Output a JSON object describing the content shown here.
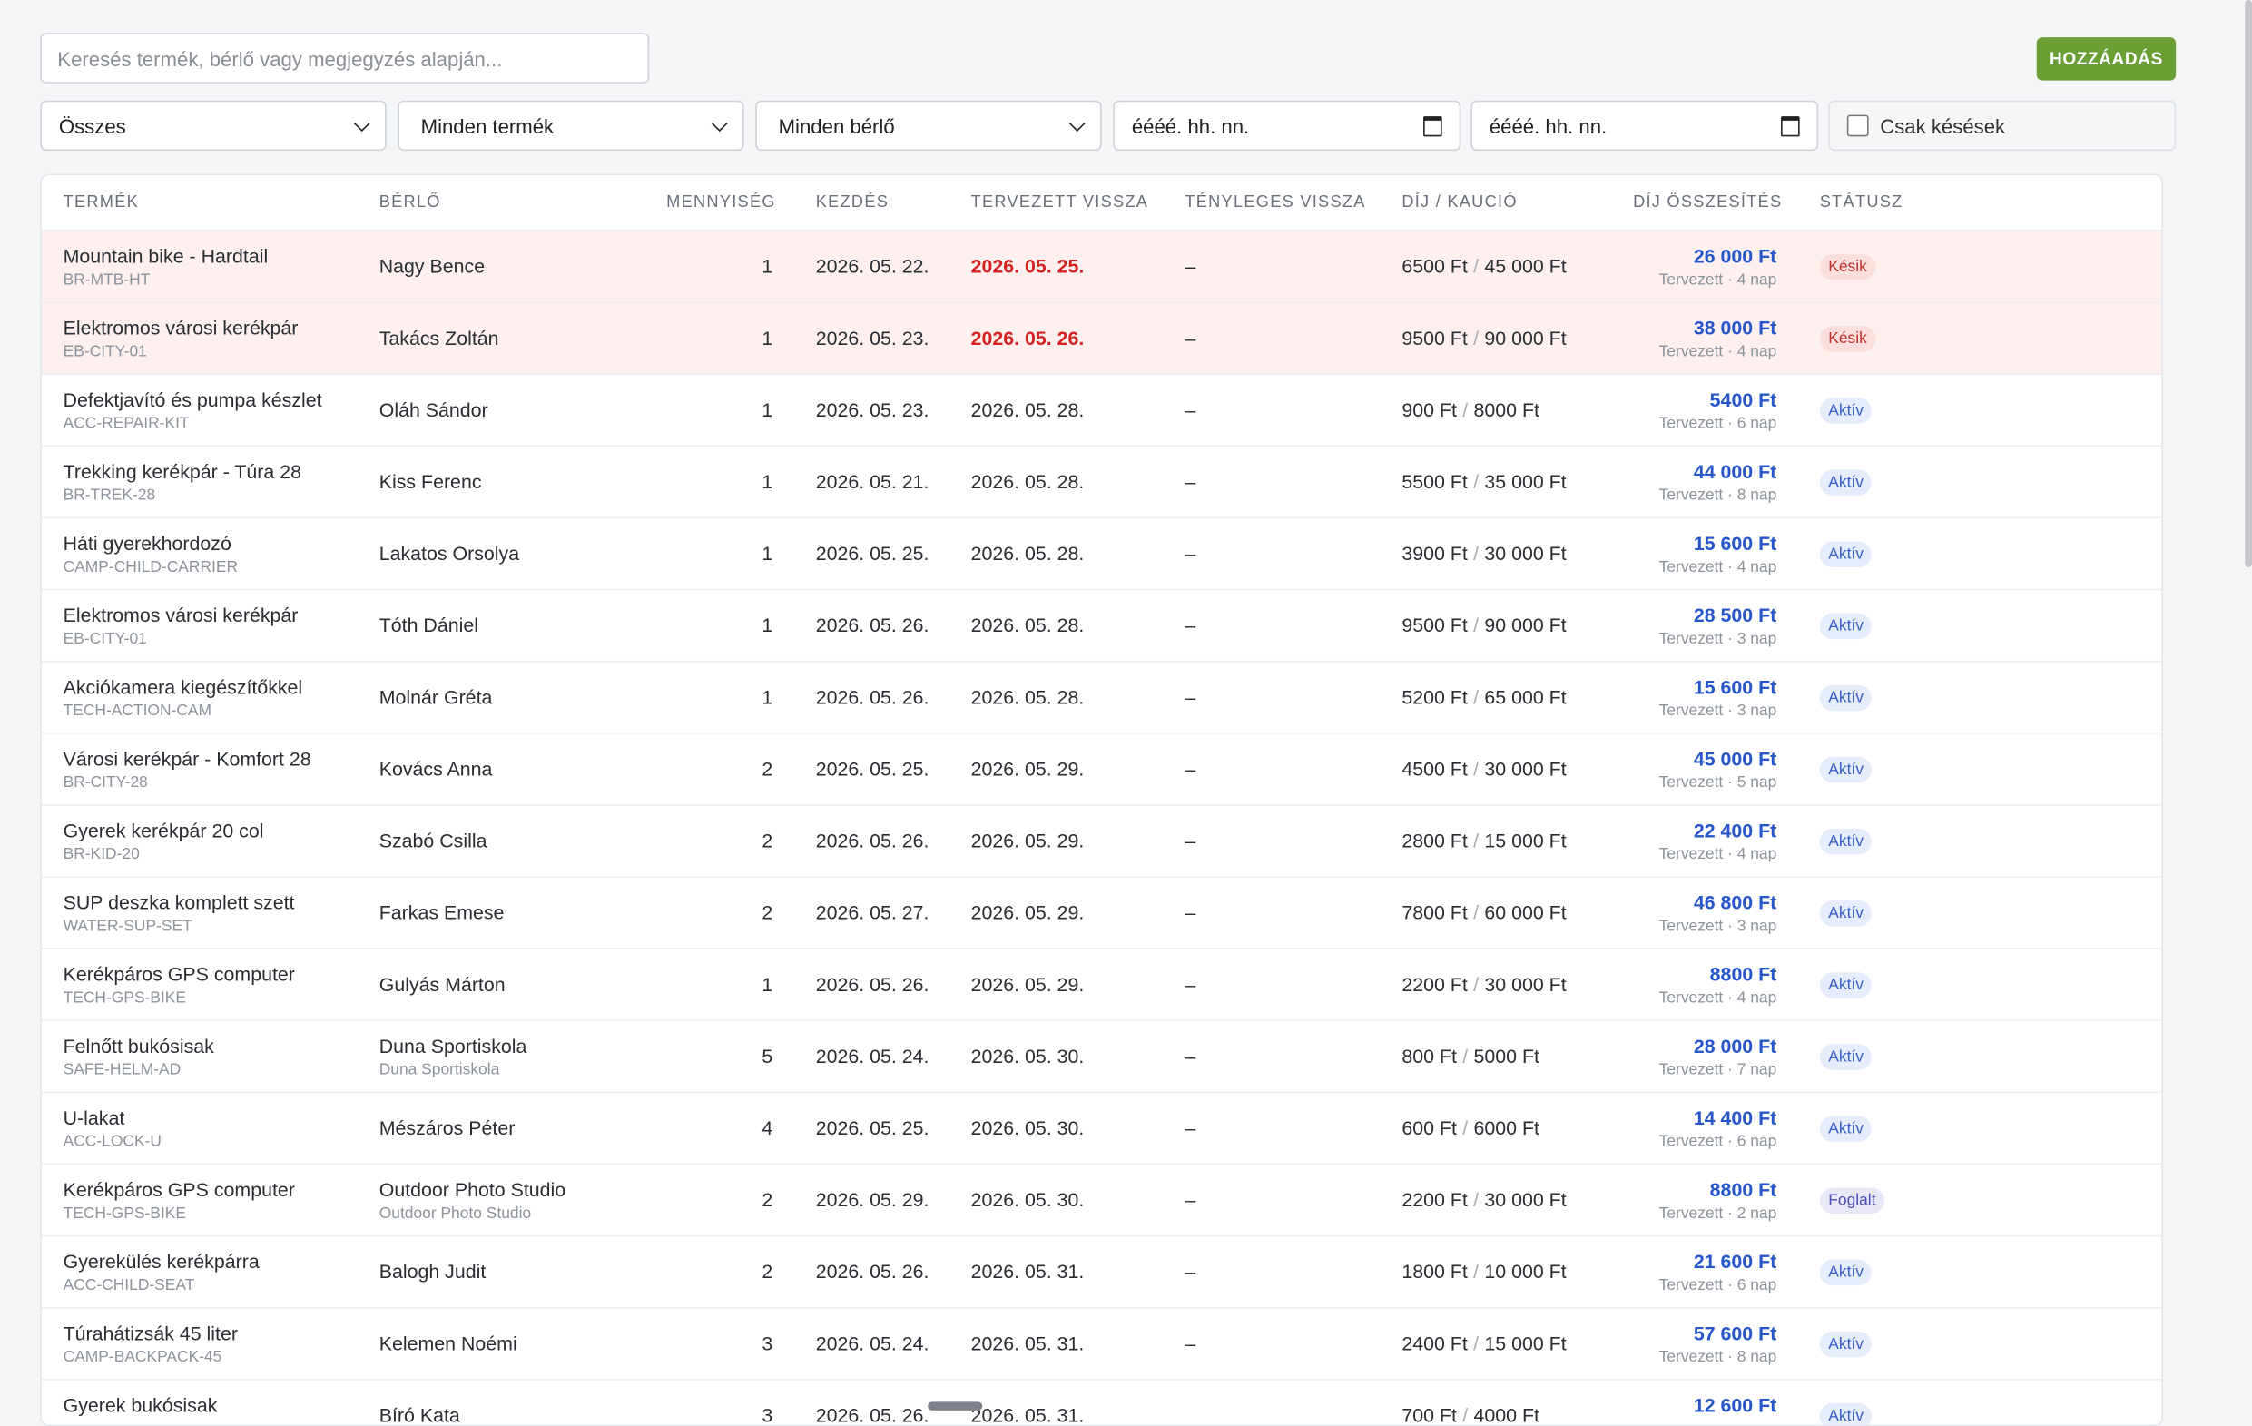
{
  "search": {
    "placeholder": "Keresés termék, bérlő vagy megjegyzés alapján..."
  },
  "toolbar": {
    "add_label": "HOZZÁADÁS"
  },
  "filters": {
    "status": "Összes",
    "product": "Minden termék",
    "renter": "Minden bérlő",
    "date_from": "éééé. hh. nn.",
    "date_to": "éééé. hh. nn.",
    "late_only": "Csak késések"
  },
  "table": {
    "headers": [
      "TERMÉK",
      "BÉRLŐ",
      "MENNYISÉG",
      "KEZDÉS",
      "TERVEZETT VISSZA",
      "TÉNYLEGES VISSZA",
      "DÍJ / KAUCIÓ",
      "DÍJ ÖSSZESÍTÉS",
      "STÁTUSZ"
    ],
    "rows": [
      {
        "product": "Mountain bike - Hardtail",
        "code": "BR-MTB-HT",
        "renter": "Nagy Bence",
        "renter_sub": "",
        "qty": "1",
        "start": "2026. 05. 22.",
        "planned": "2026. 05. 25.",
        "actual": "–",
        "fee": "6500 Ft",
        "deposit": "45 000 Ft",
        "total": "26 000 Ft",
        "total_sub": "Tervezett · 4 nap",
        "status": "Késik",
        "kind": "late"
      },
      {
        "product": "Elektromos városi kerékpár",
        "code": "EB-CITY-01",
        "renter": "Takács Zoltán",
        "renter_sub": "",
        "qty": "1",
        "start": "2026. 05. 23.",
        "planned": "2026. 05. 26.",
        "actual": "–",
        "fee": "9500 Ft",
        "deposit": "90 000 Ft",
        "total": "38 000 Ft",
        "total_sub": "Tervezett · 4 nap",
        "status": "Késik",
        "kind": "late"
      },
      {
        "product": "Defektjavító és pumpa készlet",
        "code": "ACC-REPAIR-KIT",
        "renter": "Oláh Sándor",
        "renter_sub": "",
        "qty": "1",
        "start": "2026. 05. 23.",
        "planned": "2026. 05. 28.",
        "actual": "–",
        "fee": "900 Ft",
        "deposit": "8000 Ft",
        "total": "5400 Ft",
        "total_sub": "Tervezett · 6 nap",
        "status": "Aktív",
        "kind": "active"
      },
      {
        "product": "Trekking kerékpár - Túra 28",
        "code": "BR-TREK-28",
        "renter": "Kiss Ferenc",
        "renter_sub": "",
        "qty": "1",
        "start": "2026. 05. 21.",
        "planned": "2026. 05. 28.",
        "actual": "–",
        "fee": "5500 Ft",
        "deposit": "35 000 Ft",
        "total": "44 000 Ft",
        "total_sub": "Tervezett · 8 nap",
        "status": "Aktív",
        "kind": "active"
      },
      {
        "product": "Háti gyerekhordozó",
        "code": "CAMP-CHILD-CARRIER",
        "renter": "Lakatos Orsolya",
        "renter_sub": "",
        "qty": "1",
        "start": "2026. 05. 25.",
        "planned": "2026. 05. 28.",
        "actual": "–",
        "fee": "3900 Ft",
        "deposit": "30 000 Ft",
        "total": "15 600 Ft",
        "total_sub": "Tervezett · 4 nap",
        "status": "Aktív",
        "kind": "active"
      },
      {
        "product": "Elektromos városi kerékpár",
        "code": "EB-CITY-01",
        "renter": "Tóth Dániel",
        "renter_sub": "",
        "qty": "1",
        "start": "2026. 05. 26.",
        "planned": "2026. 05. 28.",
        "actual": "–",
        "fee": "9500 Ft",
        "deposit": "90 000 Ft",
        "total": "28 500 Ft",
        "total_sub": "Tervezett · 3 nap",
        "status": "Aktív",
        "kind": "active"
      },
      {
        "product": "Akciókamera kiegészítőkkel",
        "code": "TECH-ACTION-CAM",
        "renter": "Molnár Gréta",
        "renter_sub": "",
        "qty": "1",
        "start": "2026. 05. 26.",
        "planned": "2026. 05. 28.",
        "actual": "–",
        "fee": "5200 Ft",
        "deposit": "65 000 Ft",
        "total": "15 600 Ft",
        "total_sub": "Tervezett · 3 nap",
        "status": "Aktív",
        "kind": "active"
      },
      {
        "product": "Városi kerékpár - Komfort 28",
        "code": "BR-CITY-28",
        "renter": "Kovács Anna",
        "renter_sub": "",
        "qty": "2",
        "start": "2026. 05. 25.",
        "planned": "2026. 05. 29.",
        "actual": "–",
        "fee": "4500 Ft",
        "deposit": "30 000 Ft",
        "total": "45 000 Ft",
        "total_sub": "Tervezett · 5 nap",
        "status": "Aktív",
        "kind": "active"
      },
      {
        "product": "Gyerek kerékpár 20 col",
        "code": "BR-KID-20",
        "renter": "Szabó Csilla",
        "renter_sub": "",
        "qty": "2",
        "start": "2026. 05. 26.",
        "planned": "2026. 05. 29.",
        "actual": "–",
        "fee": "2800 Ft",
        "deposit": "15 000 Ft",
        "total": "22 400 Ft",
        "total_sub": "Tervezett · 4 nap",
        "status": "Aktív",
        "kind": "active"
      },
      {
        "product": "SUP deszka komplett szett",
        "code": "WATER-SUP-SET",
        "renter": "Farkas Emese",
        "renter_sub": "",
        "qty": "2",
        "start": "2026. 05. 27.",
        "planned": "2026. 05. 29.",
        "actual": "–",
        "fee": "7800 Ft",
        "deposit": "60 000 Ft",
        "total": "46 800 Ft",
        "total_sub": "Tervezett · 3 nap",
        "status": "Aktív",
        "kind": "active"
      },
      {
        "product": "Kerékpáros GPS computer",
        "code": "TECH-GPS-BIKE",
        "renter": "Gulyás Márton",
        "renter_sub": "",
        "qty": "1",
        "start": "2026. 05. 26.",
        "planned": "2026. 05. 29.",
        "actual": "–",
        "fee": "2200 Ft",
        "deposit": "30 000 Ft",
        "total": "8800 Ft",
        "total_sub": "Tervezett · 4 nap",
        "status": "Aktív",
        "kind": "active"
      },
      {
        "product": "Felnőtt bukósisak",
        "code": "SAFE-HELM-AD",
        "renter": "Duna Sportiskola",
        "renter_sub": "Duna Sportiskola",
        "qty": "5",
        "start": "2026. 05. 24.",
        "planned": "2026. 05. 30.",
        "actual": "–",
        "fee": "800 Ft",
        "deposit": "5000 Ft",
        "total": "28 000 Ft",
        "total_sub": "Tervezett · 7 nap",
        "status": "Aktív",
        "kind": "active"
      },
      {
        "product": "U-lakat",
        "code": "ACC-LOCK-U",
        "renter": "Mészáros Péter",
        "renter_sub": "",
        "qty": "4",
        "start": "2026. 05. 25.",
        "planned": "2026. 05. 30.",
        "actual": "–",
        "fee": "600 Ft",
        "deposit": "6000 Ft",
        "total": "14 400 Ft",
        "total_sub": "Tervezett · 6 nap",
        "status": "Aktív",
        "kind": "active"
      },
      {
        "product": "Kerékpáros GPS computer",
        "code": "TECH-GPS-BIKE",
        "renter": "Outdoor Photo Studio",
        "renter_sub": "Outdoor Photo Studio",
        "qty": "2",
        "start": "2026. 05. 29.",
        "planned": "2026. 05. 30.",
        "actual": "–",
        "fee": "2200 Ft",
        "deposit": "30 000 Ft",
        "total": "8800 Ft",
        "total_sub": "Tervezett · 2 nap",
        "status": "Foglalt",
        "kind": "booked"
      },
      {
        "product": "Gyerekülés kerékpárra",
        "code": "ACC-CHILD-SEAT",
        "renter": "Balogh Judit",
        "renter_sub": "",
        "qty": "2",
        "start": "2026. 05. 26.",
        "planned": "2026. 05. 31.",
        "actual": "–",
        "fee": "1800 Ft",
        "deposit": "10 000 Ft",
        "total": "21 600 Ft",
        "total_sub": "Tervezett · 6 nap",
        "status": "Aktív",
        "kind": "active"
      },
      {
        "product": "Túrahátizsák 45 liter",
        "code": "CAMP-BACKPACK-45",
        "renter": "Kelemen Noémi",
        "renter_sub": "",
        "qty": "3",
        "start": "2026. 05. 24.",
        "planned": "2026. 05. 31.",
        "actual": "–",
        "fee": "2400 Ft",
        "deposit": "15 000 Ft",
        "total": "57 600 Ft",
        "total_sub": "Tervezett · 8 nap",
        "status": "Aktív",
        "kind": "active"
      },
      {
        "product": "Gyerek bukósisak",
        "code": "",
        "renter": "Bíró Kata",
        "renter_sub": "",
        "qty": "3",
        "start": "2026. 05. 26.",
        "planned": "2026. 05. 31.",
        "actual": "",
        "fee": "700 Ft",
        "deposit": "4000 Ft",
        "total": "12 600 Ft",
        "total_sub": "",
        "status": "Aktív",
        "kind": "active"
      }
    ]
  }
}
